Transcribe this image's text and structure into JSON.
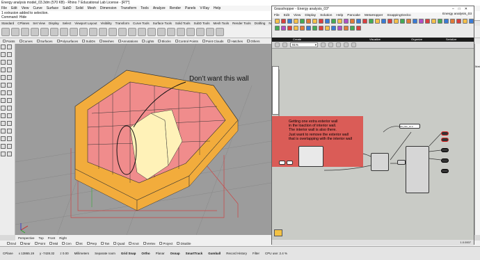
{
  "rhino": {
    "title": "Energy analysis model_03.3dm (570 KB) - Rhino 7 Educational Lab License - [RT*]",
    "menu": [
      "File",
      "Edit",
      "View",
      "Curve",
      "Surface",
      "SubD",
      "Solid",
      "Mesh",
      "Dimension",
      "Transform",
      "Tools",
      "Analyze",
      "Render",
      "Panels",
      "V-Ray",
      "Help"
    ],
    "command_history": "1 extrusion added to selection.",
    "command_line": "Command: Hide",
    "command_prompt": "Command",
    "tabs": [
      "Standard",
      "CPlanes",
      "Set View",
      "Display",
      "Select",
      "Viewport Layout",
      "Visibility",
      "Transform",
      "Curve Tools",
      "Surface Tools",
      "Solid Tools",
      "SubD Tools",
      "Mesh Tools",
      "Render Tools",
      "Drafting",
      "New in V7"
    ],
    "snap_filters": [
      "Points",
      "Curves",
      "Surfaces",
      "Polysurfaces",
      "SubDs",
      "Meshes",
      "Annotations",
      "Lights",
      "Blocks",
      "Control Points",
      "Point Clouds",
      "Hatches",
      "Others"
    ],
    "viewport_tabs": [
      "Perspective",
      "Top",
      "Front",
      "Right"
    ],
    "osnaps": [
      "End",
      "Near",
      "Point",
      "Mid",
      "Cen",
      "Int",
      "Perp",
      "Tan",
      "Quad",
      "Knot",
      "Vertex",
      "Project",
      "Disable"
    ],
    "status": {
      "cplane": "CPlane",
      "x": "x 13865.19",
      "y": "y -7428.32",
      "z": "z 0.00",
      "units": "Millimeters",
      "layer": "Separate room",
      "buttons": [
        "Grid Snap",
        "Ortho",
        "Planar",
        "Osnap",
        "SmartTrack",
        "Gumball",
        "Record History",
        "Filter"
      ],
      "cpu": "CPU use: 2.4 %"
    },
    "annotation": "Don’t want this wall",
    "right_panel_label": "Materia"
  },
  "grasshopper": {
    "title": "Grasshopper - Energy analysis_03*",
    "document_name": "Energy analysis_03",
    "menu": [
      "File",
      "Edit",
      "View",
      "Display",
      "Solution",
      "Help",
      "Pancake",
      "MetaHopper",
      "SnappingGecko"
    ],
    "groups": [
      "Create",
      "Visualize",
      "Organize",
      "Serialize"
    ],
    "zoom": "91%",
    "note_lines": [
      "Getting one extra exterior wall",
      "in the loaction of interior wall.",
      "The interior wall is also there.",
      "Just want to remove the exterior wall",
      "that is overlapping with the interior wall"
    ],
    "version": "1.0.0007",
    "panel_label": "Rhl_Min_10.0",
    "colors": {
      "note": "#da5c57",
      "canvas": "#c9cbc6",
      "building_orange": "#f2ac3c",
      "floor_pink": "#f08c8c",
      "selected_wall": "#fff2b8"
    }
  }
}
